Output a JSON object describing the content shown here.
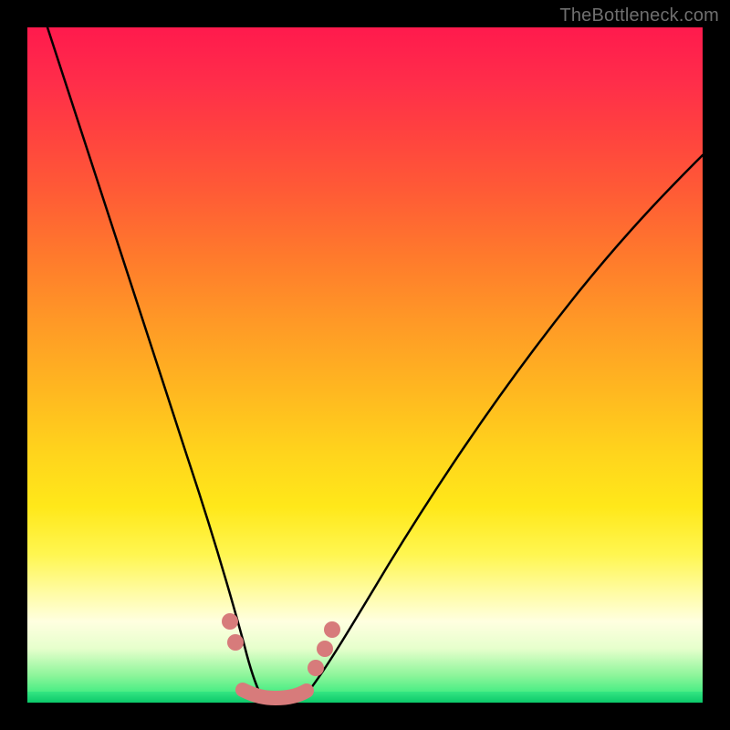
{
  "watermark": "TheBottleneck.com",
  "colors": {
    "bg": "#000000",
    "curve": "#000000",
    "marker": "#d77b7b",
    "gradient_top": "#ff1a4d",
    "gradient_bottom": "#1de876"
  },
  "chart_data": {
    "type": "line",
    "title": "",
    "xlabel": "",
    "ylabel": "",
    "xlim": [
      0,
      100
    ],
    "ylim": [
      0,
      100
    ],
    "series": [
      {
        "name": "left-curve",
        "x": [
          3,
          6,
          10,
          14,
          18,
          22,
          25,
          27,
          29,
          31,
          32,
          33,
          34
        ],
        "y": [
          100,
          87,
          73,
          60,
          48,
          36,
          26,
          19,
          13,
          7,
          4,
          2,
          0
        ]
      },
      {
        "name": "right-curve",
        "x": [
          40,
          42,
          45,
          49,
          54,
          60,
          67,
          75,
          84,
          93,
          100
        ],
        "y": [
          0,
          3,
          8,
          15,
          24,
          34,
          45,
          56,
          66,
          75,
          81
        ]
      },
      {
        "name": "valley-floor",
        "x": [
          33,
          34,
          35,
          36,
          37,
          38,
          39,
          40,
          41
        ],
        "y": [
          1,
          0.5,
          0.2,
          0.1,
          0.1,
          0.1,
          0.2,
          0.5,
          1
        ]
      }
    ],
    "markers": {
      "floor": {
        "x": [
          32,
          41
        ],
        "y": [
          1,
          1.5
        ]
      },
      "dots": [
        {
          "x": 29.5,
          "y": 11
        },
        {
          "x": 30.5,
          "y": 8
        },
        {
          "x": 42.5,
          "y": 5
        },
        {
          "x": 44,
          "y": 8
        },
        {
          "x": 45,
          "y": 11
        }
      ]
    }
  }
}
